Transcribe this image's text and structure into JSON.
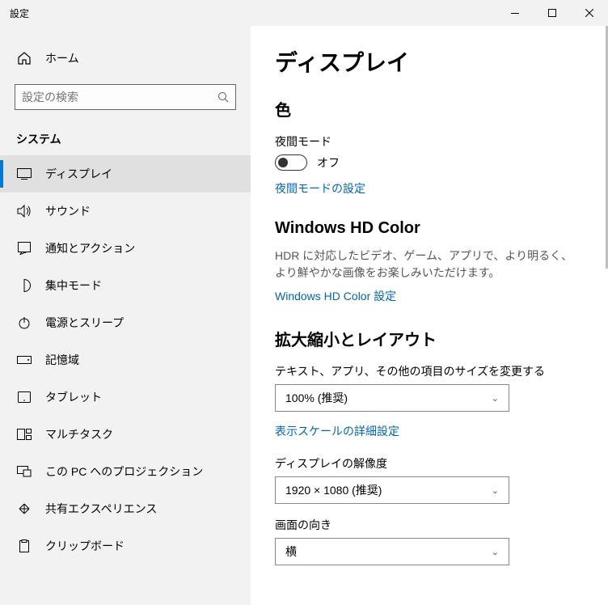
{
  "titlebar": {
    "title": "設定"
  },
  "sidebar": {
    "home": "ホーム",
    "search_placeholder": "設定の検索",
    "category": "システム",
    "items": [
      {
        "label": "ディスプレイ"
      },
      {
        "label": "サウンド"
      },
      {
        "label": "通知とアクション"
      },
      {
        "label": "集中モード"
      },
      {
        "label": "電源とスリープ"
      },
      {
        "label": "記憶域"
      },
      {
        "label": "タブレット"
      },
      {
        "label": "マルチタスク"
      },
      {
        "label": "この PC へのプロジェクション"
      },
      {
        "label": "共有エクスペリエンス"
      },
      {
        "label": "クリップボード"
      }
    ]
  },
  "main": {
    "page_title": "ディスプレイ",
    "color_heading": "色",
    "night_mode_label": "夜間モード",
    "night_mode_state": "オフ",
    "night_mode_settings": "夜間モードの設定",
    "hdcolor_heading": "Windows HD Color",
    "hdcolor_desc": "HDR に対応したビデオ、ゲーム、アプリで、より明るく、より鮮やかな画像をお楽しみいただけます。",
    "hdcolor_link": "Windows HD Color 設定",
    "scale_heading": "拡大縮小とレイアウト",
    "scale_label": "テキスト、アプリ、その他の項目のサイズを変更する",
    "scale_value": "100% (推奨)",
    "scale_link": "表示スケールの詳細設定",
    "res_label": "ディスプレイの解像度",
    "res_value": "1920 × 1080 (推奨)",
    "orient_label": "画面の向き",
    "orient_value": "横"
  }
}
